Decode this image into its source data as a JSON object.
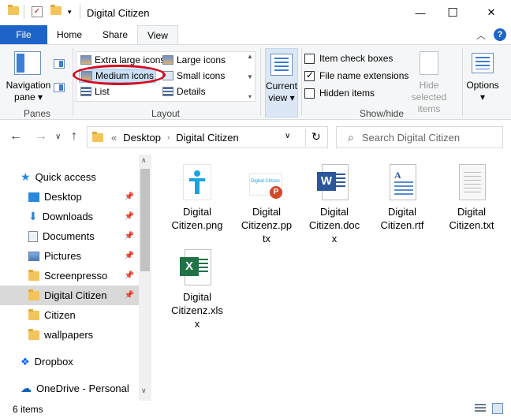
{
  "window": {
    "title": "Digital Citizen",
    "controls": {
      "minimize": "—",
      "maximize": "☐",
      "close": "✕"
    }
  },
  "ribbon_tabs": [
    "File",
    "Home",
    "Share",
    "View"
  ],
  "ribbon": {
    "panes": {
      "navigation_pane_line1": "Navigation",
      "navigation_pane_line2": "pane",
      "label": "Panes"
    },
    "layout": {
      "items": [
        "Extra large icons",
        "Large icons",
        "Medium icons",
        "Small icons",
        "List",
        "Details"
      ],
      "selected": "Medium icons",
      "label": "Layout"
    },
    "current_view": {
      "line1": "Current",
      "line2": "view"
    },
    "show_hide": {
      "item_check_boxes": "Item check boxes",
      "file_name_extensions": "File name extensions",
      "hidden_items": "Hidden items",
      "hide_selected_line1": "Hide selected",
      "hide_selected_line2": "items",
      "label": "Show/hide"
    },
    "options": "Options"
  },
  "address": {
    "separator": "«",
    "crumbs": [
      "Desktop",
      "Digital Citizen"
    ],
    "search_placeholder": "Search Digital Citizen"
  },
  "nav_pane": {
    "items": [
      "Quick access",
      "Desktop",
      "Downloads",
      "Documents",
      "Pictures",
      "Screenpresso",
      "Digital Citizen",
      "Citizen",
      "wallpapers",
      "Dropbox",
      "OneDrive - Personal"
    ],
    "selected": "Digital Citizen"
  },
  "files": [
    {
      "line1": "Digital",
      "line2": "Citizen.png",
      "line3": "",
      "type": "png"
    },
    {
      "line1": "Digital",
      "line2": "Citizenz.pp",
      "line3": "tx",
      "type": "pptx"
    },
    {
      "line1": "Digital",
      "line2": "Citizen.doc",
      "line3": "x",
      "type": "docx"
    },
    {
      "line1": "Digital",
      "line2": "Citizen.rtf",
      "line3": "",
      "type": "rtf"
    },
    {
      "line1": "Digital",
      "line2": "Citizen.txt",
      "line3": "",
      "type": "txt"
    },
    {
      "line1": "Digital",
      "line2": "Citizenz.xls",
      "line3": "x",
      "type": "xlsx"
    }
  ],
  "ppt_thumb_text": "Digital Citizen",
  "status": {
    "count": "6 items"
  },
  "colors": {
    "accent": "#1e64c8",
    "highlight_circle": "#d8001a",
    "word": "#2b579a",
    "excel": "#217346",
    "ppt": "#d24726"
  }
}
